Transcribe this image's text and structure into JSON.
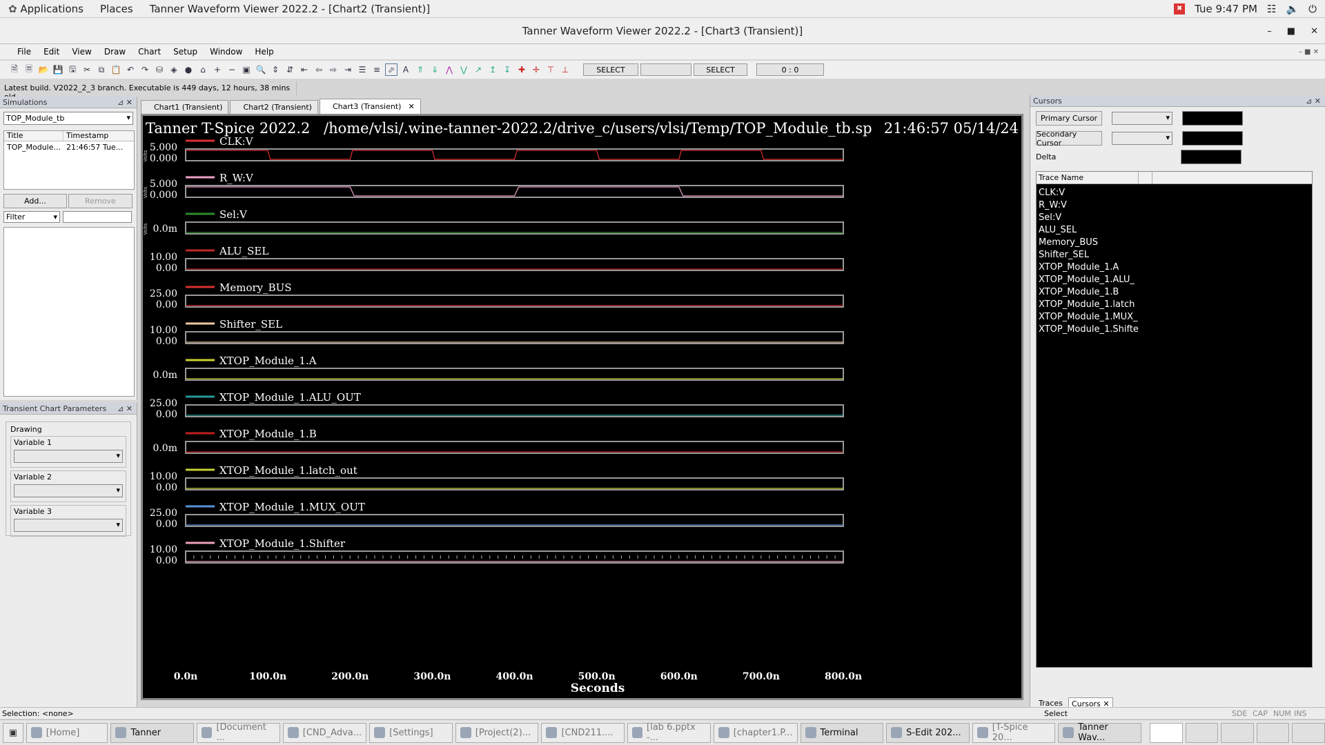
{
  "topbar": {
    "applications": "Applications",
    "places": "Places",
    "window": "Tanner Waveform Viewer 2022.2 - [Chart2 (Transient)]",
    "clock": "Tue  9:47 PM"
  },
  "window": {
    "title": "Tanner Waveform Viewer 2022.2 - [Chart3 (Transient)]"
  },
  "menu": [
    "File",
    "Edit",
    "View",
    "Draw",
    "Chart",
    "Setup",
    "Window",
    "Help"
  ],
  "toolbar": {
    "select1": "SELECT",
    "select2": "SELECT",
    "coord": "0 : 0"
  },
  "infobar": "Latest build. V2022_2_3 branch. Executable is 449 days, 12 hours, 38 mins old.",
  "simulations": {
    "header": "Simulations",
    "selected": "TOP_Module_tb",
    "col_title": "Title",
    "col_timestamp": "Timestamp",
    "row_title": "TOP_Module...",
    "row_timestamp": "21:46:57 Tue...",
    "add": "Add...",
    "remove": "Remove",
    "filter": "Filter"
  },
  "params": {
    "header": "Transient Chart Parameters",
    "drawing": "Drawing",
    "var1": "Variable 1",
    "var2": "Variable 2",
    "var3": "Variable 3"
  },
  "tabs": [
    "Chart1 (Transient)",
    "Chart2 (Transient)",
    "Chart3 (Transient)"
  ],
  "chart_header": {
    "left": "Tanner T-Spice 2022.2",
    "path": "/home/vlsi/.wine-tanner-2022.2/drive_c/users/vlsi/Temp/TOP_Module_tb.sp",
    "time": "21:46:57 05/14/24"
  },
  "chart_data": {
    "type": "line",
    "xlabel": "Seconds",
    "xlim": [
      0,
      800
    ],
    "x_ticks": [
      "0.0n",
      "100.0n",
      "200.0n",
      "300.0n",
      "400.0n",
      "500.0n",
      "600.0n",
      "700.0n",
      "800.0n"
    ],
    "series": [
      {
        "name": "CLK:V",
        "color": "#e03030",
        "ymax_label": "5.000",
        "ymin_label": "0.000",
        "unit_label": "Volts",
        "ylim": [
          0,
          5
        ],
        "points": [
          [
            0,
            5
          ],
          [
            100,
            5
          ],
          [
            103,
            0
          ],
          [
            200,
            0
          ],
          [
            203,
            5
          ],
          [
            300,
            5
          ],
          [
            303,
            0
          ],
          [
            400,
            0
          ],
          [
            403,
            5
          ],
          [
            500,
            5
          ],
          [
            503,
            0
          ],
          [
            600,
            0
          ],
          [
            603,
            5
          ],
          [
            700,
            5
          ],
          [
            703,
            0
          ],
          [
            800,
            0
          ]
        ]
      },
      {
        "name": "R_W:V",
        "color": "#f0a0c8",
        "ymax_label": "5.000",
        "ymin_label": "0.000",
        "unit_label": "Volts",
        "ylim": [
          0,
          5
        ],
        "points": [
          [
            0,
            5
          ],
          [
            200,
            5
          ],
          [
            205,
            0
          ],
          [
            400,
            0
          ],
          [
            405,
            5
          ],
          [
            600,
            5
          ],
          [
            605,
            0
          ],
          [
            800,
            0
          ]
        ]
      },
      {
        "name": "Sel:V",
        "color": "#2e8b2e",
        "ymax_label": "",
        "ymin_label": "0.0m",
        "unit_label": "Volts",
        "ylim": [
          0,
          1
        ],
        "points": [
          [
            0,
            0
          ],
          [
            800,
            0
          ]
        ]
      },
      {
        "name": "ALU_SEL",
        "color": "#c02828",
        "ymax_label": "10.00",
        "ymin_label": "0.00",
        "ylim": [
          0,
          10
        ],
        "points": [
          [
            0,
            0
          ],
          [
            800,
            0
          ]
        ]
      },
      {
        "name": "Memory_BUS",
        "color": "#d83030",
        "ymax_label": "25.00",
        "ymin_label": "0.00",
        "ylim": [
          0,
          25
        ],
        "points": [
          [
            0,
            0
          ],
          [
            800,
            0
          ]
        ]
      },
      {
        "name": "Shifter_SEL",
        "color": "#f0c8a0",
        "ymax_label": "10.00",
        "ymin_label": "0.00",
        "ylim": [
          0,
          10
        ],
        "points": [
          [
            0,
            0
          ],
          [
            800,
            0
          ]
        ]
      },
      {
        "name": "XTOP_Module_1.A",
        "color": "#c8d030",
        "ymax_label": "",
        "ymin_label": "0.0m",
        "ylim": [
          0,
          1
        ],
        "points": [
          [
            0,
            0
          ],
          [
            800,
            0
          ]
        ]
      },
      {
        "name": "XTOP_Module_1.ALU_OUT",
        "color": "#2a9a9a",
        "ymax_label": "25.00",
        "ymin_label": "0.00",
        "ylim": [
          0,
          25
        ],
        "points": [
          [
            0,
            0
          ],
          [
            800,
            0
          ]
        ]
      },
      {
        "name": "XTOP_Module_1.B",
        "color": "#c02020",
        "ymax_label": "",
        "ymin_label": "0.0m",
        "ylim": [
          0,
          1
        ],
        "points": [
          [
            0,
            0
          ],
          [
            800,
            0
          ]
        ]
      },
      {
        "name": "XTOP_Module_1.latch_out",
        "color": "#c8d030",
        "ymax_label": "10.00",
        "ymin_label": "0.00",
        "ylim": [
          0,
          10
        ],
        "points": [
          [
            0,
            0
          ],
          [
            800,
            0
          ]
        ]
      },
      {
        "name": "XTOP_Module_1.MUX_OUT",
        "color": "#5a90d8",
        "ymax_label": "25.00",
        "ymin_label": "0.00",
        "ylim": [
          0,
          25
        ],
        "points": [
          [
            0,
            0
          ],
          [
            800,
            0
          ]
        ]
      },
      {
        "name": "XTOP_Module_1.Shifter",
        "color": "#f0a0c0",
        "ymax_label": "10.00",
        "ymin_label": "0.00",
        "ylim": [
          0,
          10
        ],
        "points": [
          [
            0,
            0
          ],
          [
            800,
            0
          ]
        ]
      }
    ]
  },
  "cursors": {
    "header": "Cursors",
    "primary": "Primary Cursor",
    "secondary": "Secondary Cursor",
    "delta": "Delta",
    "trace_col": "Trace Name",
    "traces": [
      "CLK:V",
      "R_W:V",
      "Sel:V",
      "ALU_SEL",
      "Memory_BUS",
      "Shifter_SEL",
      "XTOP_Module_1.A",
      "XTOP_Module_1.ALU_",
      "XTOP_Module_1.B",
      "XTOP_Module_1.latch",
      "XTOP_Module_1.MUX_",
      "XTOP_Module_1.Shifte"
    ],
    "tab_traces": "Traces",
    "tab_cursors": "Cursors"
  },
  "status": {
    "selection": "Selection: <none>",
    "mid": "Select",
    "sde": "SDE",
    "cap": "CAP",
    "num": "NUM",
    "ins": "INS"
  },
  "taskbar": [
    {
      "label": "[Home]",
      "active": false
    },
    {
      "label": "Tanner",
      "active": true
    },
    {
      "label": "[Document ...",
      "active": false
    },
    {
      "label": "[CND_Adva...",
      "active": false
    },
    {
      "label": "[Settings]",
      "active": false
    },
    {
      "label": "[Project(2)...",
      "active": false
    },
    {
      "label": "[CND211....",
      "active": false
    },
    {
      "label": "[lab 6.pptx -...",
      "active": false
    },
    {
      "label": "[chapter1.P...",
      "active": false
    },
    {
      "label": "Terminal",
      "active": true
    },
    {
      "label": "S-Edit 202...",
      "active": true
    },
    {
      "label": "[T-Spice 20...",
      "active": false
    },
    {
      "label": "Tanner Wav...",
      "active": true
    }
  ]
}
